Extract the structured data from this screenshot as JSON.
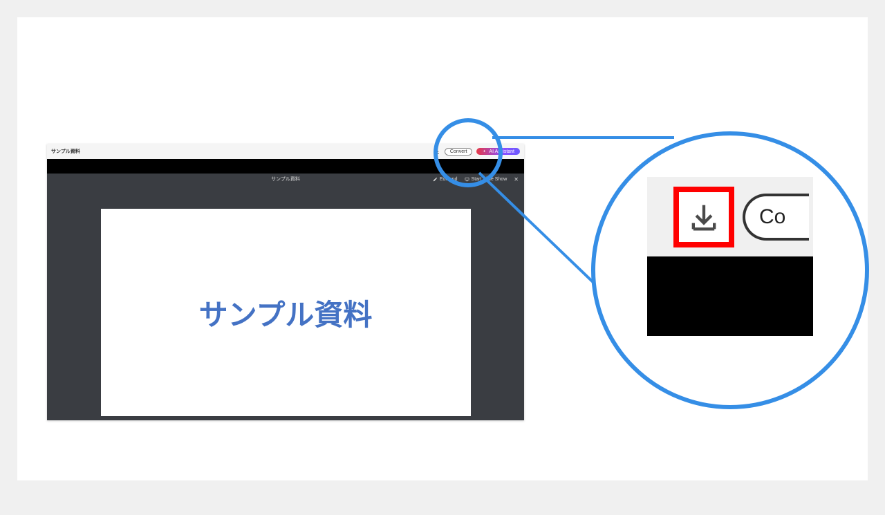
{
  "colors": {
    "accent": "#358ee6",
    "highlight": "#ff0000",
    "slideTitle": "#4472c4"
  },
  "app": {
    "title": "サンプル資料",
    "topbar": {
      "convert": "Convert",
      "ai_assistant": "AI Assistant"
    },
    "subbar": {
      "title": "サンプル資料",
      "edit": "Edit and",
      "start_slideshow": "Start Slide Show",
      "close": "✕"
    },
    "slide": {
      "title": "サンプル資料"
    }
  },
  "magnifier": {
    "convert_partial": "Co"
  }
}
